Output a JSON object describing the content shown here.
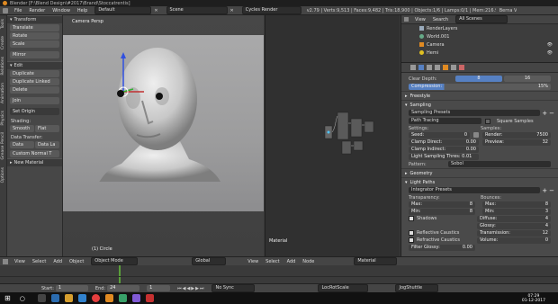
{
  "titlebar": {
    "title": "Blender [F:\\Blend Design\\#2017\\Brand\\Stoccatrentis]"
  },
  "infobar": {
    "menus": [
      "File",
      "Render",
      "Window",
      "Help"
    ],
    "layout": "Default",
    "scene": "Scene",
    "engine": "Cycles Render",
    "stats": "v2.79 | Verts:9,513 | Faces:9,482 | Tris:18,900 | Objects:1/6 | Lamps:0/1 | Mem:216.96M | Circle",
    "user": "Berna V"
  },
  "toolshelf": {
    "tabs": [
      "Tools",
      "Create",
      "Relations",
      "Animation",
      "Physics",
      "Grease Pencil",
      "Options",
      "Shading",
      "Bool"
    ],
    "transform_header": "Transform",
    "transform_items": [
      "Translate",
      "Rotate",
      "Scale",
      "Mirror"
    ],
    "edit_header": "Edit",
    "edit_items": [
      "Duplicate",
      "Duplicate Linked",
      "Delete",
      "Join"
    ],
    "set_origin": "Set Origin",
    "shading_header": "Shading:",
    "smooth": "Smooth",
    "flat": "Flat",
    "data_transfer_header": "Data Transfer:",
    "data": "Data",
    "data_la": "Data La",
    "custom_normal": "Custom Normal T",
    "new_material": "New Material"
  },
  "viewport": {
    "label": "Camera Persp",
    "object_label": "(1) Circle"
  },
  "nodes": {
    "label": "Material"
  },
  "outliner": {
    "menus": [
      "View",
      "Search"
    ],
    "filter": "All Scenes",
    "items": [
      {
        "name": "RenderLayers",
        "icon": "renderlayers-icon"
      },
      {
        "name": "World.001",
        "icon": "world-icon"
      },
      {
        "name": "Camera",
        "icon": "camera-icon"
      },
      {
        "name": "Hemi",
        "icon": "lamp-icon"
      }
    ]
  },
  "props": {
    "clear_color": "Clear Depth:",
    "clear_val_a": "8",
    "clear_val_b": "16",
    "compression_label": "Compression:",
    "compression_val": "15%",
    "freestyle": "Freestyle",
    "sampling": "Sampling",
    "sampling_presets": "Sampling Presets",
    "path_tracing": "Path Tracing",
    "square_samples": "Square Samples",
    "settings": "Settings:",
    "samples": "Samples:",
    "seed_label": "Seed:",
    "seed_val": "0",
    "render_label": "Render:",
    "render_val": "7500",
    "clamp_direct": "Clamp Direct:",
    "clamp_direct_val": "0.00",
    "preview_label": "Preview:",
    "preview_val": "32",
    "clamp_indirect": "Clamp Indirect:",
    "clamp_indirect_val": "0.00",
    "light_threshold": "Light Sampling Thres: 0.01",
    "pattern": "Pattern:",
    "pattern_val": "Sobol",
    "geometry": "Geometry",
    "light_paths": "Light Paths",
    "integrator_presets": "Integrator Presets",
    "transparency": "Transparency:",
    "bounces": "Bounces:",
    "t_max": "Max:",
    "t_max_val": "8",
    "t_min": "Min:",
    "t_min_val": "8",
    "b_max": "Max:",
    "b_max_val": "8",
    "b_min": "Min:",
    "b_min_val": "3",
    "shadows": "Shadows",
    "diffuse": "Diffuse:",
    "diffuse_val": "4",
    "glossy": "Glossy:",
    "glossy_val": "4",
    "reflective": "Reflective Caustics",
    "transmission": "Transmission:",
    "transmission_val": "12",
    "refractive": "Refractive Caustics",
    "volume": "Volume:",
    "volume_val": "0",
    "filter_glossy": "Filter Glossy:",
    "filter_glossy_val": "0.00"
  },
  "bottom3d": {
    "menus": [
      "View",
      "Select",
      "Add",
      "Object"
    ],
    "mode": "Object Mode",
    "orientation": "Global"
  },
  "bottomnode": {
    "menus": [
      "View",
      "Select",
      "Add",
      "Node"
    ],
    "material": "Material"
  },
  "timeline_hdr": {
    "start_label": "Start:",
    "start_val": "1",
    "end_label": "End:",
    "end_val": "24",
    "current": "1",
    "sync": "No Sync",
    "keying": "LocRotScale",
    "extra": "JogShuttle"
  },
  "taskbar": {
    "time": "07:29",
    "date": "01-12-2017"
  },
  "colors": {
    "accent": "#5680c2",
    "orange": "#e08a22"
  }
}
